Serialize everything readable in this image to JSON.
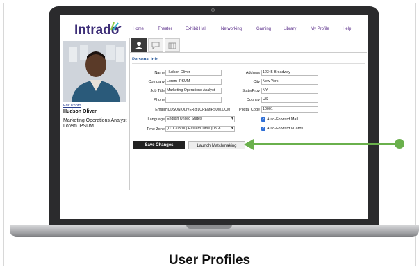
{
  "caption": "User Profiles",
  "app": {
    "logo": "Intrado",
    "nav": [
      "Home",
      "Theater",
      "Exhibit Hall",
      "Networking",
      "Gaming",
      "Library",
      "My Profile",
      "Help"
    ]
  },
  "profile": {
    "edit_photo": "Edit Photo",
    "name": "Hudson Oliver",
    "title": "Marketing Operations Analyst",
    "company": "Lorem IPSUM"
  },
  "form": {
    "section_title": "Personal Info",
    "labels": {
      "name": "Name",
      "company": "Company",
      "job_title": "Job Title",
      "phone": "Phone",
      "email": "Email",
      "language": "Language",
      "time_zone": "Time Zone",
      "address": "Address",
      "city": "City",
      "state": "State/Prov",
      "country": "Country",
      "postal": "Postal Code"
    },
    "values": {
      "name": "Hudson Oliver",
      "company": "Lorem IPSUM",
      "job_title": "Marketing Operations Analyst",
      "phone": "",
      "email": "HUDSON.OLIVER@LOREMIPSUM.COM",
      "language": "English United States",
      "time_zone": "(UTC-05:00) Eastern Time (US &",
      "address": "12345 Broadway",
      "city": "New York",
      "state": "NY",
      "country": "US",
      "postal": "10001"
    },
    "checkboxes": {
      "auto_forward_mail": "Auto-Forward Mail",
      "auto_forward_vcards": "Auto-Forward vCards"
    },
    "buttons": {
      "save": "Save Changes",
      "matchmaking": "Launch Matchmaking"
    }
  },
  "colors": {
    "accent_arrow": "#6ab04c",
    "logo": "#3d2e78",
    "nav": "#5a2e8a"
  }
}
